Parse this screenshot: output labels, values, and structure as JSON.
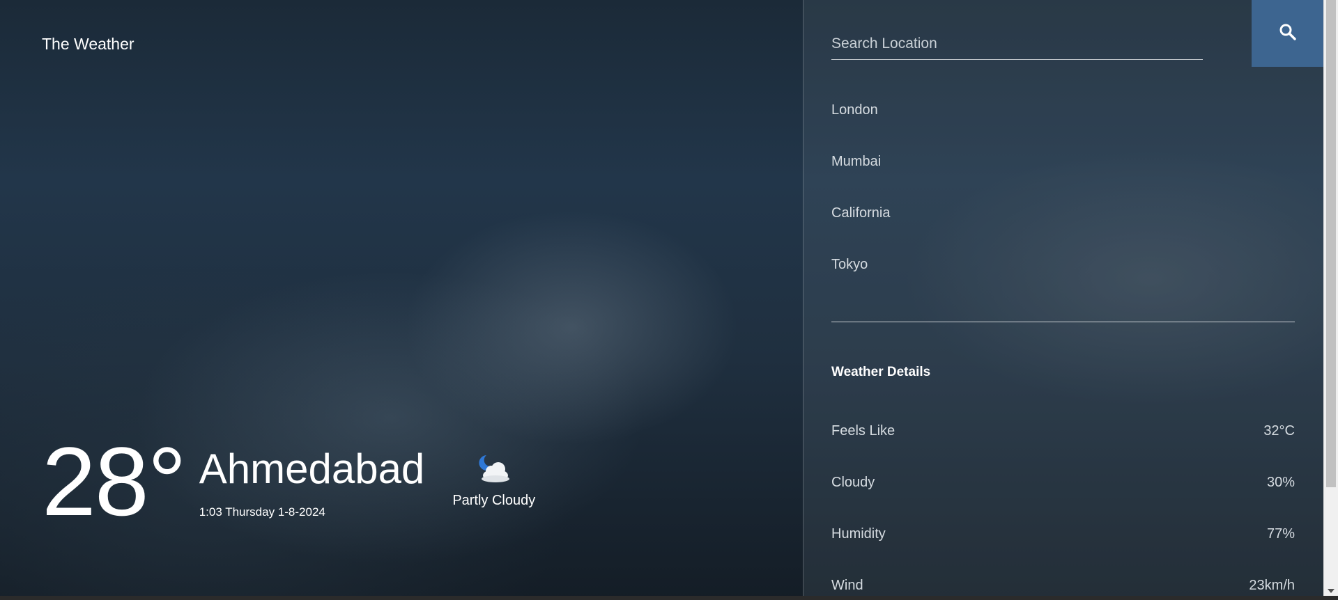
{
  "app": {
    "title": "The Weather"
  },
  "current": {
    "temperature": "28°",
    "city": "Ahmedabad",
    "datetime": "1:03 Thursday 1-8-2024",
    "condition": "Partly Cloudy",
    "condition_icon": "partly-cloudy-night-icon"
  },
  "search": {
    "placeholder": "Search Location",
    "value": "",
    "button_icon": "search-icon"
  },
  "locations": [
    {
      "label": "London"
    },
    {
      "label": "Mumbai"
    },
    {
      "label": "California"
    },
    {
      "label": "Tokyo"
    }
  ],
  "details": {
    "title": "Weather Details",
    "rows": [
      {
        "label": "Feels Like",
        "value": "32°C"
      },
      {
        "label": "Cloudy",
        "value": "30%"
      },
      {
        "label": "Humidity",
        "value": "77%"
      },
      {
        "label": "Wind",
        "value": "23km/h"
      }
    ]
  },
  "colors": {
    "accent": "#3d6590",
    "text": "#ffffff",
    "muted_text": "#d6dce1"
  }
}
